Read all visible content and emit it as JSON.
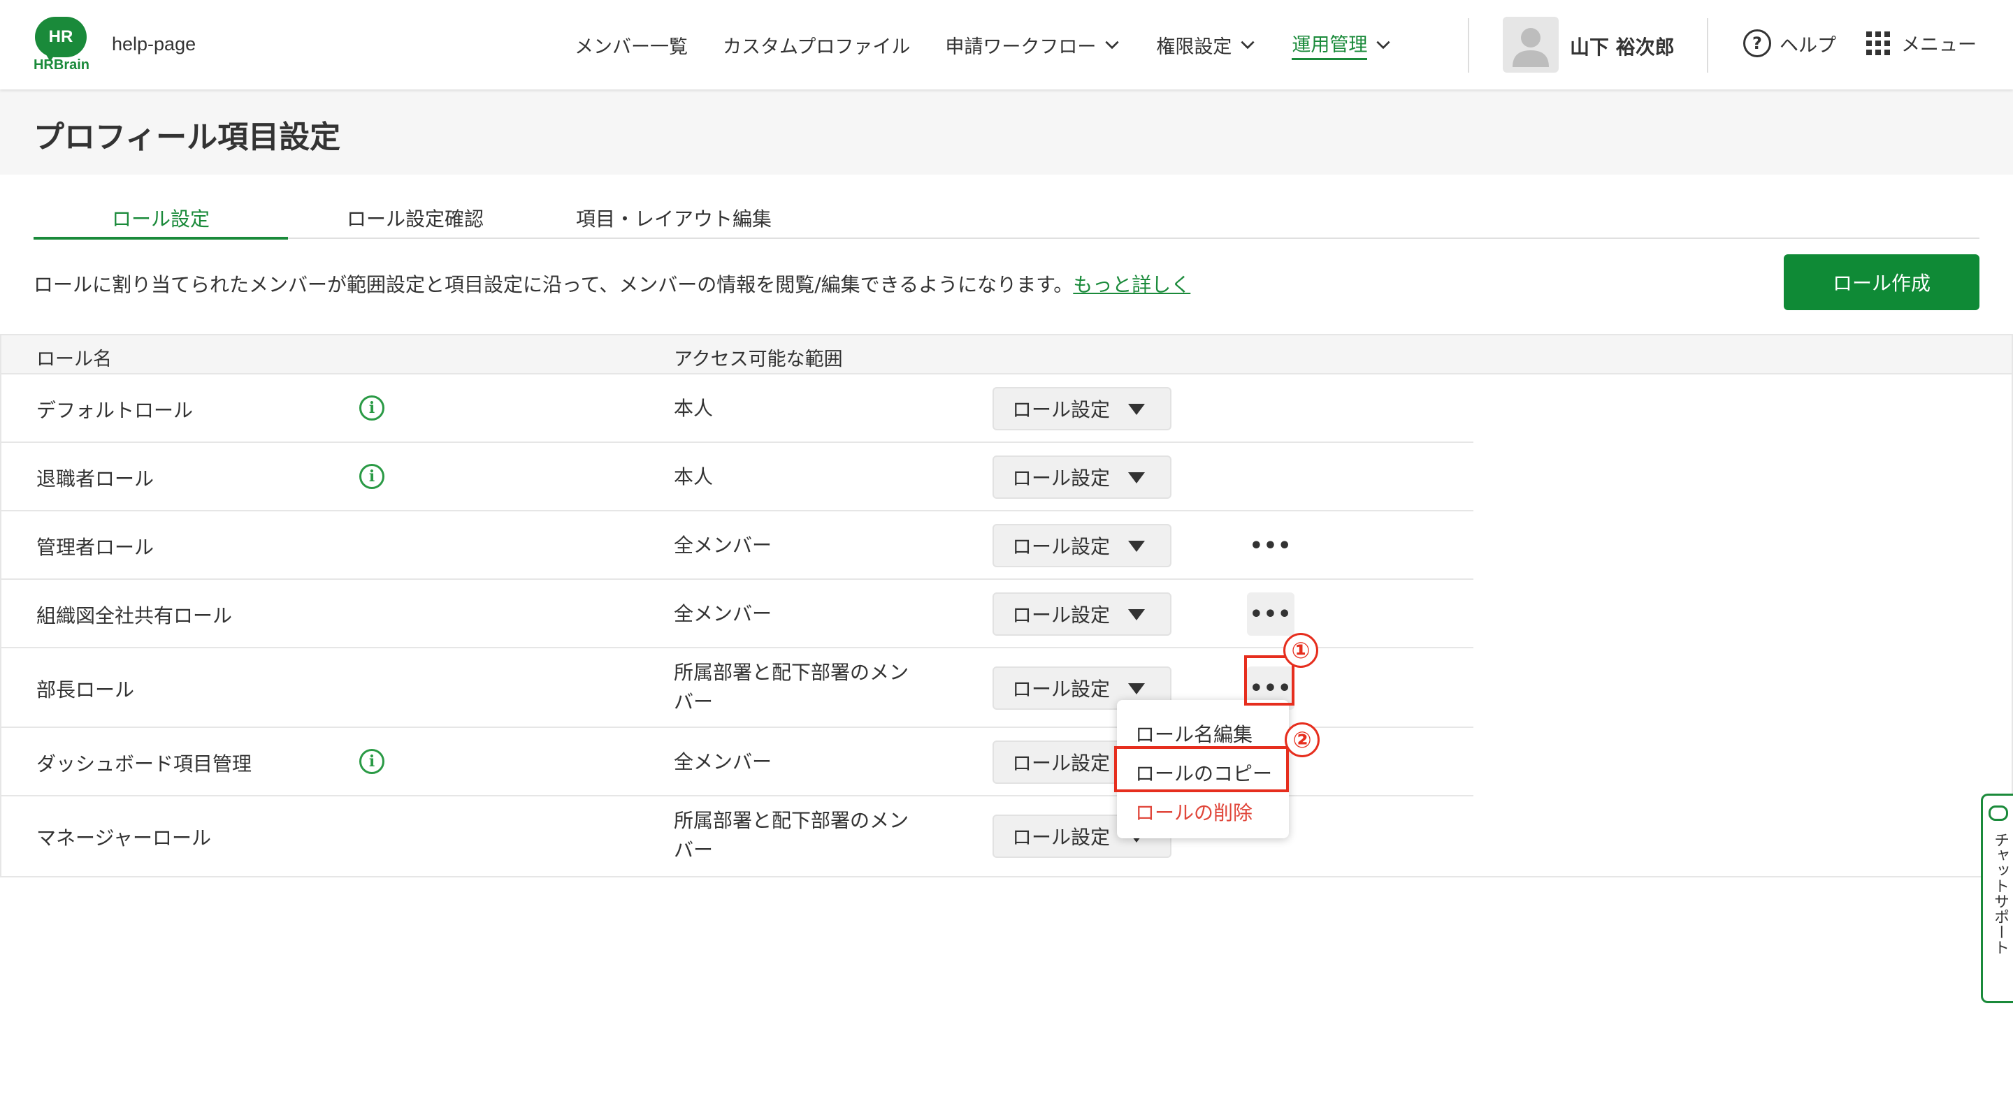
{
  "header": {
    "logo_text": "HR",
    "logo_sub": "HRBrain",
    "site_name": "help-page",
    "nav": [
      {
        "label": "メンバー一覧"
      },
      {
        "label": "カスタムプロファイル"
      },
      {
        "label": "申請ワークフロー"
      },
      {
        "label": "権限設定"
      },
      {
        "label": "運用管理"
      }
    ],
    "user_name": "山下 裕次郎",
    "help_label": "ヘルプ",
    "menu_label": "メニュー"
  },
  "page": {
    "title": "プロフィール項目設定",
    "tabs": [
      {
        "label": "ロール設定"
      },
      {
        "label": "ロール設定確認"
      },
      {
        "label": "項目・レイアウト編集"
      }
    ],
    "description": "ロールに割り当てられたメンバーが範囲設定と項目設定に沿って、メンバーの情報を閲覧/編集できるようになります。",
    "more_link": "もっと詳しく",
    "create_button": "ロール作成"
  },
  "table": {
    "col_name": "ロール名",
    "col_scope": "アクセス可能な範囲",
    "rows": [
      {
        "name": "デフォルトロール",
        "scope": "本人",
        "action": "ロール設定"
      },
      {
        "name": "退職者ロール",
        "scope": "本人",
        "action": "ロール設定"
      },
      {
        "name": "管理者ロール",
        "scope": "全メンバー",
        "action": "ロール設定",
        "more": "•••"
      },
      {
        "name": "組織図全社共有ロール",
        "scope": "全メンバー",
        "action": "ロール設定",
        "more": "•••"
      },
      {
        "name": "部長ロール",
        "scope": "所属部署と配下部署のメンバー",
        "action": "ロール設定",
        "more": "•••"
      },
      {
        "name": "ダッシュボード項目管理",
        "scope": "全メンバー",
        "action": "ロール設定"
      },
      {
        "name": "マネージャーロール",
        "scope": "所属部署と配下部署のメンバー",
        "action": "ロール設定"
      }
    ]
  },
  "dropdown": {
    "items": [
      "ロール名編集",
      "ロールのコピー",
      "ロールの削除"
    ]
  },
  "annotations": {
    "step1": "①",
    "step2": "②"
  },
  "chat_support": "チャットサポート",
  "colors": {
    "brand": "#1a8a3a",
    "button": "#0f8a36",
    "danger": "#e0463a",
    "annotation": "#e62e1e"
  }
}
